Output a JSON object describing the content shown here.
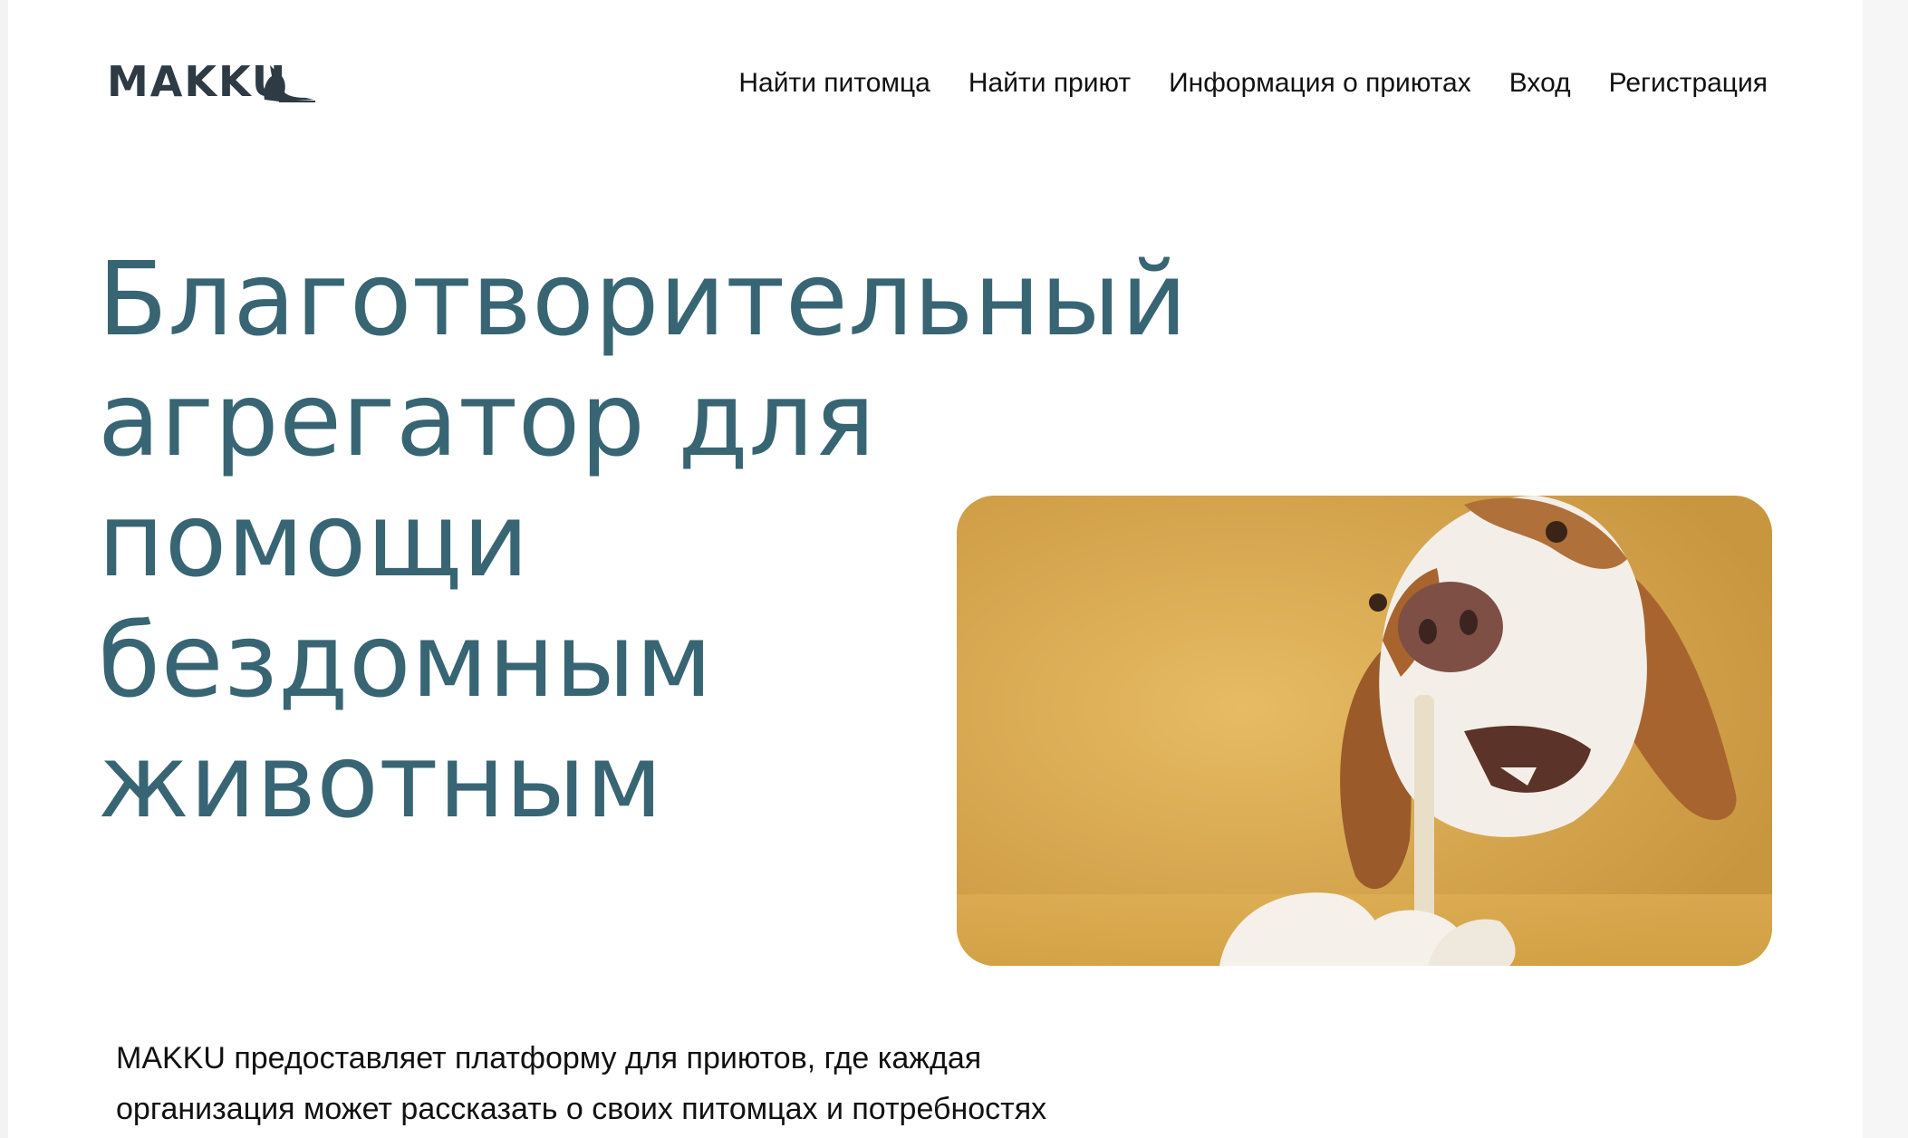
{
  "header": {
    "logo_text": "MAKKU",
    "nav": [
      {
        "label": "Найти питомца"
      },
      {
        "label": "Найти приют"
      },
      {
        "label": "Информация о приютах"
      },
      {
        "label": "Вход"
      },
      {
        "label": "Регистрация"
      }
    ]
  },
  "hero": {
    "title_lines": [
      "Благотворительный",
      "агрегатор для помощи",
      "бездомным",
      "животным"
    ],
    "image_icon": "dog-photo"
  },
  "description": {
    "lines": [
      "MAKKU предоставляет платформу для приютов, где каждая",
      "организация может рассказать о своих питомцах и потребностях"
    ]
  },
  "colors": {
    "title": "#386573",
    "text": "#111111",
    "image_bg": "#ddb055"
  }
}
